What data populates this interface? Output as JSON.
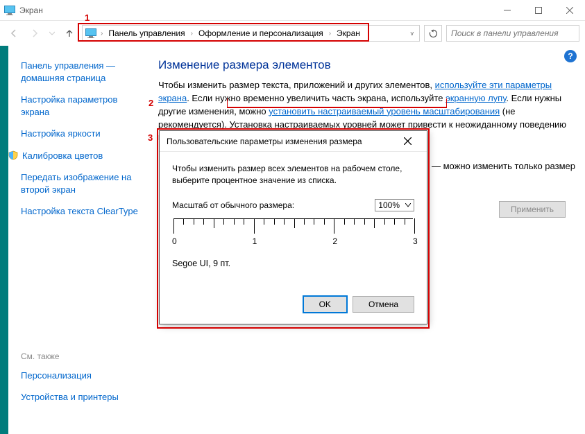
{
  "window": {
    "title": "Экран",
    "search_placeholder": "Поиск в панели управления"
  },
  "breadcrumb": {
    "items": [
      "Панель управления",
      "Оформление и персонализация",
      "Экран"
    ]
  },
  "annotations": {
    "n1": "1",
    "n2": "2",
    "n3": "3"
  },
  "sidebar": {
    "home": "Панель управления — домашняя страница",
    "items": [
      "Настройка параметров экрана",
      "Настройка яркости",
      "Калибровка цветов",
      "Передать изображение на второй экран",
      "Настройка текста ClearType"
    ],
    "footer_head": "См. также",
    "footer_items": [
      "Персонализация",
      "Устройства и принтеры"
    ]
  },
  "main": {
    "title": "Изменение размера элементов",
    "p1a": "Чтобы изменить размер текста, приложений и других элементов, ",
    "link1": "используйте эти параметры экрана",
    "p1b": ". Если нужно временно увеличить часть экрана, используйте ",
    "link2": "экранную лупу",
    "p1c": ". Если нужны другие изменения, можно ",
    "link3": "установить настраиваемый уровень масштабирования",
    "p1d": " (не рекомендуется). Установка настраиваемых уровней может привести к неожиданному поведению на некоторых экранах.",
    "outside_text": "— можно изменить только размер",
    "apply": "Применить"
  },
  "dialog": {
    "title": "Пользовательские параметры изменения размера",
    "desc": "Чтобы изменить размер всех элементов на рабочем столе, выберите процентное значение из списка.",
    "scale_label": "Масштаб от обычного размера:",
    "scale_value": "100%",
    "ruler_labels": [
      "0",
      "1",
      "2",
      "3"
    ],
    "sample": "Segoe UI, 9 пт.",
    "ok": "OK",
    "cancel": "Отмена"
  }
}
